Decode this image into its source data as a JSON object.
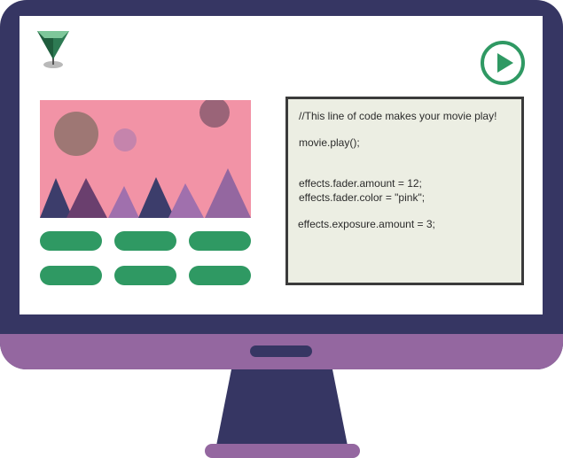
{
  "code_editor": {
    "lines": [
      "//This line of code makes your movie play!",
      "movie.play();",
      "effects.fader.amount = 12;",
      "effects.fader.color = \"pink\";",
      "effects.exposure.amount = 3;"
    ]
  },
  "icons": {
    "logo": "green-gem-pin-logo",
    "play": "play-circle-icon"
  },
  "effect_buttons": {
    "count": 6,
    "color": "#2f9963"
  },
  "colors": {
    "monitor_frame": "#363663",
    "monitor_chin": "#9467a0",
    "movie_background": "#f293a6",
    "accent_green": "#2f9963",
    "code_background": "#eceee3"
  }
}
